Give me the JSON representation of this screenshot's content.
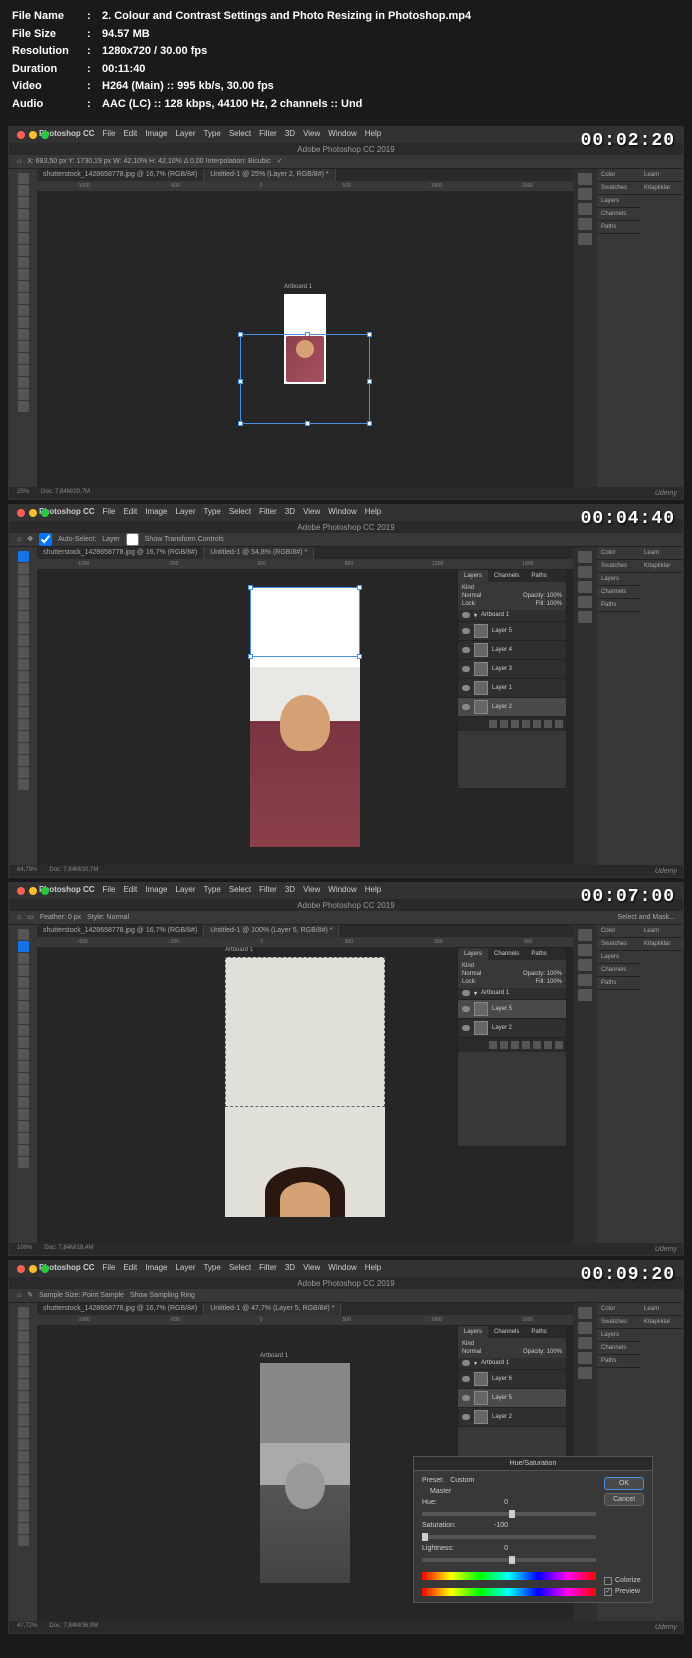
{
  "meta": {
    "filename_label": "File Name",
    "filename": "2. Colour and Contrast Settings and Photo Resizing in Photoshop.mp4",
    "filesize_label": "File Size",
    "filesize": "94.57 MB",
    "resolution_label": "Resolution",
    "resolution": "1280x720 / 30.00 fps",
    "duration_label": "Duration",
    "duration": "00:11:40",
    "video_label": "Video",
    "video": "H264 (Main) :: 995 kb/s, 30.00 fps",
    "audio_label": "Audio",
    "audio": "AAC (LC) :: 128 kbps, 44100 Hz, 2 channels :: Und",
    "sep": ":"
  },
  "menus": [
    "Photoshop CC",
    "File",
    "Edit",
    "Image",
    "Layer",
    "Type",
    "Select",
    "Filter",
    "3D",
    "View",
    "Window",
    "Help"
  ],
  "app_title": "Adobe Photoshop CC 2019",
  "ruler_marks": [
    "-1000",
    "-700",
    "-500",
    "-200",
    "0",
    "300",
    "500",
    "800",
    "1000",
    "1300",
    "1600",
    "1800"
  ],
  "dock": {
    "color": "Color",
    "swatches": "Swatches",
    "layers": "Layers",
    "channels": "Channels",
    "paths": "Paths",
    "learn": "Learn",
    "kitapliklar": "Kitaplıklar"
  },
  "artboard_label": "Artboard 1",
  "udemy": "Udemy",
  "frames": [
    {
      "timestamp": "00:02:20",
      "options": "X: 683,50 px  Y: 1730,19 px  W: 42,10%  H: 42,10%  Δ 0,00  Interpolation: Bicubic",
      "tab1": "shutterstock_1428658778.jpg @ 16,7% (RGB/8#)",
      "tab2": "Untitled-1 @ 25% (Layer 2, RGB/8#) *",
      "zoom": "25%",
      "doc": "Doc: 7,84M/20,7M"
    },
    {
      "timestamp": "00:04:40",
      "options_auto": "Auto-Select:",
      "options_layer": "Layer",
      "options_show": "Show Transform Controls",
      "tab1": "shutterstock_1428658778.jpg @ 16,7% (RGB/8#)",
      "tab2": "Untitled-1 @ 54,8% (RGB/8#) *",
      "zoom": "64,79%",
      "doc": "Doc: 7,84M/20,7M",
      "layers_panel": {
        "tabs": [
          "Layers",
          "Channels",
          "Paths"
        ],
        "kind": "Kind",
        "normal": "Normal",
        "opacity_label": "Opacity:",
        "opacity": "100%",
        "lock_label": "Lock:",
        "fill_label": "Fill:",
        "fill": "100%",
        "layers": [
          "Artboard 1",
          "Layer 5",
          "Layer 4",
          "Layer 3",
          "Layer 1",
          "Layer 2"
        ]
      }
    },
    {
      "timestamp": "00:07:00",
      "options_feather": "Feather: 0 px",
      "options_style": "Style: Normal",
      "options_mask": "Select and Mask...",
      "tab1": "shutterstock_1428658778.jpg @ 16,7% (RGB/8#)",
      "tab2": "Untitled-1 @ 100% (Layer 5, RGB/8#) *",
      "zoom": "100%",
      "doc": "Doc: 7,84M/18,4M",
      "layers_panel": {
        "tabs": [
          "Layers",
          "Channels",
          "Paths"
        ],
        "kind": "Kind",
        "normal": "Normal",
        "opacity_label": "Opacity:",
        "opacity": "100%",
        "lock_label": "Lock:",
        "fill_label": "Fill:",
        "fill": "100%",
        "layers": [
          "Artboard 1",
          "Layer 5",
          "Layer 2"
        ]
      }
    },
    {
      "timestamp": "00:09:20",
      "options_sample": "Sample Size: Point Sample",
      "options_ring": "Show Sampling Ring",
      "tab1": "shutterstock_1428658778.jpg @ 16,7% (RGB/8#)",
      "tab2": "Untitled-1 @ 47,7% (Layer 5, RGB/8#) *",
      "zoom": "47,72%",
      "doc": "Doc: 7,84M/36,9M",
      "layers_panel": {
        "tabs": [
          "Layers",
          "Channels",
          "Paths"
        ],
        "kind": "Kind",
        "normal": "Normal",
        "opacity_label": "Opacity:",
        "opacity": "100%",
        "layers": [
          "Artboard 1",
          "Layer 6",
          "Layer 5",
          "Layer 2"
        ]
      },
      "hue_dialog": {
        "title": "Hue/Saturation",
        "preset_label": "Preset:",
        "preset": "Custom",
        "master": "Master",
        "hue_label": "Hue:",
        "hue": "0",
        "sat_label": "Saturation:",
        "sat": "-100",
        "light_label": "Lightness:",
        "light": "0",
        "ok": "OK",
        "cancel": "Cancel",
        "colorize": "Colorize",
        "preview": "Preview"
      }
    }
  ]
}
